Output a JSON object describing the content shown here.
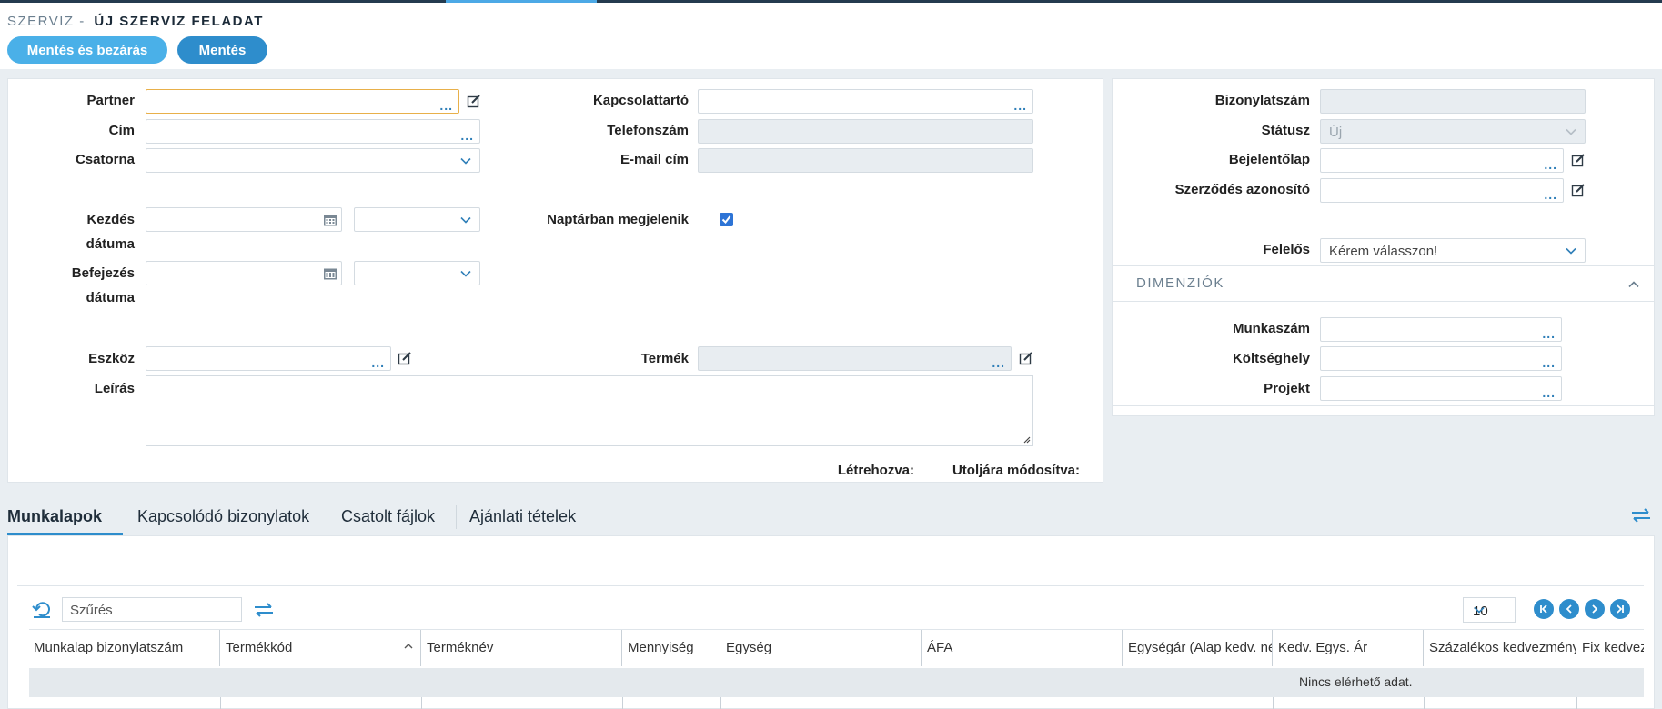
{
  "header": {
    "breadcrumb_parent": "SZERVIZ -",
    "title": "ÚJ SZERVIZ FELADAT",
    "save_close_label": "Mentés és bezárás",
    "save_label": "Mentés"
  },
  "form": {
    "partner_label": "Partner",
    "address_label": "Cím",
    "channel_label": "Csatorna",
    "contact_label": "Kapcsolattartó",
    "phone_label": "Telefonszám",
    "email_label": "E-mail cím",
    "start_date_label_1": "Kezdés",
    "start_date_label_2": "dátuma",
    "end_date_label_1": "Befejezés",
    "end_date_label_2": "dátuma",
    "calendar_label": "Naptárban megjelenik",
    "calendar_checked": true,
    "device_label": "Eszköz",
    "product_label": "Termék",
    "description_label": "Leírás",
    "created_label": "Létrehozva:",
    "modified_label": "Utoljára módosítva:"
  },
  "side": {
    "doc_number_label": "Bizonylatszám",
    "status_label": "Státusz",
    "status_value": "Új",
    "report_label": "Bejelentőlap",
    "contract_label": "Szerződés azonosító",
    "responsible_label": "Felelős",
    "responsible_value": "Kérem válasszon!",
    "dimensions_title": "DIMENZIÓK",
    "job_number_label": "Munkaszám",
    "cost_center_label": "Költséghely",
    "project_label": "Projekt"
  },
  "tabs": [
    {
      "label": "Munkalapok",
      "active": true
    },
    {
      "label": "Kapcsolódó bizonylatok",
      "active": false
    },
    {
      "label": "Csatolt fájlok",
      "active": false
    },
    {
      "label": "Ajánlati tételek",
      "active": false
    }
  ],
  "grid": {
    "filter_placeholder": "Szűrés",
    "page_size": "10",
    "columns": [
      "Munkalap bizonylatszám",
      "Termékkód",
      "Terméknév",
      "Mennyiség",
      "Egység",
      "ÁFA",
      "Egységár (Alap kedv. nélkül)",
      "Kedv. Egys. Ár",
      "Százalékos kedvezmény",
      "Fix kedvezmény"
    ],
    "no_data": "Nincs elérhető adat."
  },
  "colors": {
    "accent": "#2e8dcc",
    "accent_light": "#4ab0e8",
    "focus_border": "#e8b04a",
    "checkbox": "#2d74d6"
  }
}
